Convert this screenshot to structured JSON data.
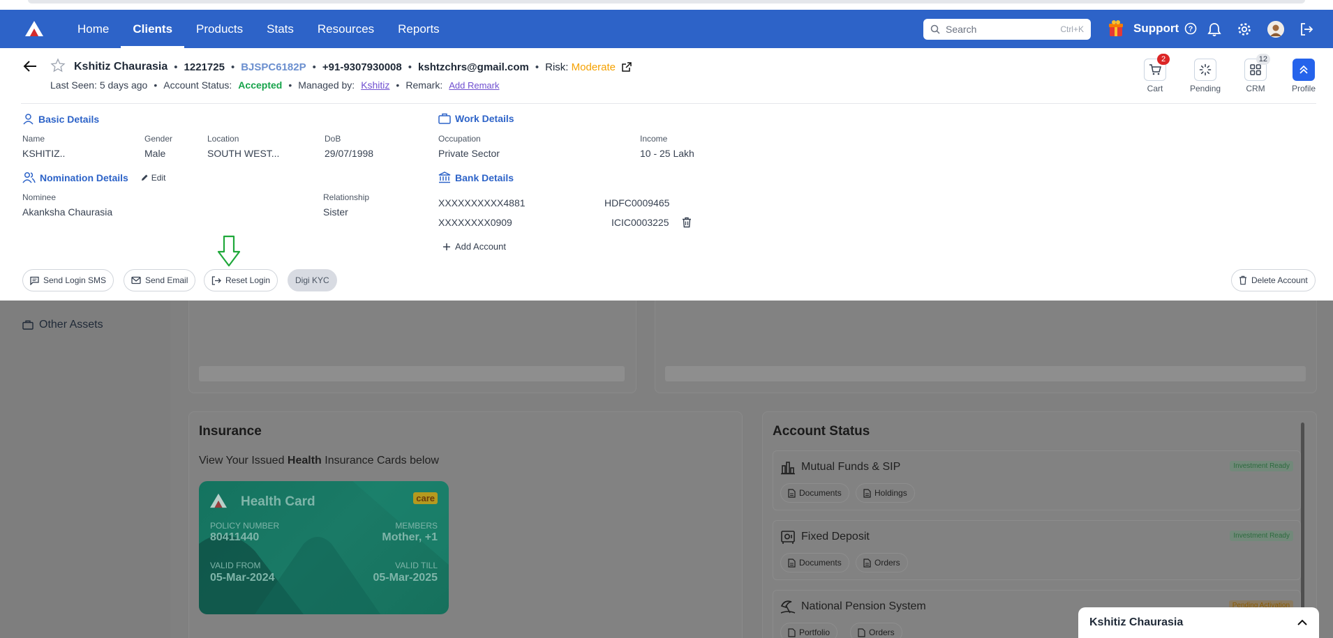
{
  "nav": {
    "links": [
      "Home",
      "Clients",
      "Products",
      "Stats",
      "Resources",
      "Reports"
    ],
    "active": "Clients",
    "search_placeholder": "Search",
    "search_shortcut": "Ctrl+K",
    "support_label": "Support",
    "icons": [
      "logo-icon",
      "gift-icon",
      "help-icon",
      "bell-icon",
      "gear-icon",
      "avatar",
      "logout-icon"
    ]
  },
  "client": {
    "name": "Kshitiz Chaurasia",
    "id": "1221725",
    "pan": "BJSPC6182P",
    "phone": "+91-9307930008",
    "email": "kshtzchrs@gmail.com",
    "risk_label": "Risk:",
    "risk_value": "Moderate",
    "last_seen": "Last Seen: 5 days ago",
    "account_status_label": "Account Status:",
    "account_status_value": "Accepted",
    "managed_by_label": "Managed by:",
    "managed_by_value": "Kshitiz",
    "remark_label": "Remark:",
    "remark_link": "Add Remark"
  },
  "quick_actions": [
    {
      "label": "Cart",
      "badge": "2"
    },
    {
      "label": "Pending",
      "badge": ""
    },
    {
      "label": "CRM",
      "badge": "12"
    },
    {
      "label": "Profile",
      "badge": ""
    }
  ],
  "basic": {
    "title": "Basic Details",
    "fields": [
      {
        "label": "Name",
        "value": "KSHITIZ.."
      },
      {
        "label": "Gender",
        "value": "Male"
      },
      {
        "label": "Location",
        "value": "SOUTH WEST..."
      },
      {
        "label": "DoB",
        "value": "29/07/1998"
      }
    ]
  },
  "work": {
    "title": "Work Details",
    "fields": [
      {
        "label": "Occupation",
        "value": "Private Sector"
      },
      {
        "label": "Income",
        "value": "10 - 25 Lakh"
      }
    ]
  },
  "nomination": {
    "title": "Nomination Details",
    "edit_label": "Edit",
    "nominee_label": "Nominee",
    "nominee_value": "Akanksha Chaurasia",
    "relationship_label": "Relationship",
    "relationship_value": "Sister"
  },
  "bank": {
    "title": "Bank Details",
    "accounts": [
      {
        "number": "XXXXXXXXXX4881",
        "ifsc": "HDFC0009465"
      },
      {
        "number": "XXXXXXXX0909",
        "ifsc": "ICIC0003225"
      }
    ],
    "add_label": "Add Account"
  },
  "actions": {
    "send_sms": "Send Login SMS",
    "send_email": "Send Email",
    "reset_login": "Reset Login",
    "digi_kyc": "Digi KYC",
    "delete_account": "Delete Account"
  },
  "sidebar": {
    "item": "Other Assets"
  },
  "insurance": {
    "title": "Insurance",
    "subtitle_pre": "View Your Issued ",
    "subtitle_bold": "Health",
    "subtitle_post": " Insurance Cards below",
    "card": {
      "title": "Health Card",
      "brand": "care",
      "policy_label": "POLICY NUMBER",
      "policy_value": "80411440",
      "members_label": "MEMBERS",
      "members_value": "Mother, +1",
      "valid_from_label": "VALID FROM",
      "valid_from_value": "05-Mar-2024",
      "valid_till_label": "VALID TILL",
      "valid_till_value": "05-Mar-2025"
    }
  },
  "account_status": {
    "title": "Account Status",
    "items": [
      {
        "name": "Mutual Funds & SIP",
        "status": "Investment Ready",
        "buttons": [
          "Documents",
          "Holdings"
        ]
      },
      {
        "name": "Fixed Deposit",
        "status": "Investment Ready",
        "buttons": [
          "Documents",
          "Orders"
        ]
      },
      {
        "name": "National Pension System",
        "status": "Pending Activation",
        "buttons": [
          "Portfolio",
          "Orders"
        ]
      }
    ]
  },
  "chat": {
    "name": "Kshitiz Chaurasia"
  },
  "colors": {
    "brand": "#2d63c8",
    "accepted": "#16a34a",
    "risk": "#f5a100",
    "danger": "#dc2626"
  }
}
